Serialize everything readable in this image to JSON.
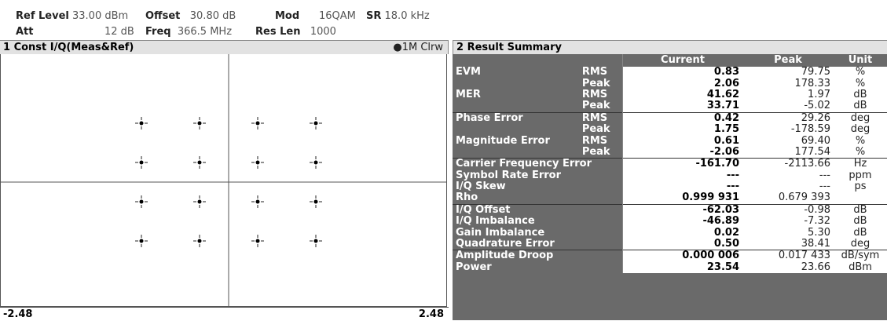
{
  "header": {
    "ref_level_label": "Ref Level",
    "ref_level_value": "33.00 dBm",
    "offset_label": "Offset",
    "offset_value": "30.80 dB",
    "mod_label": "Mod",
    "mod_value": "16QAM",
    "sr_label": "SR",
    "sr_value": "18.0 kHz",
    "att_label": "Att",
    "att_value": "12 dB",
    "freq_label": "Freq",
    "freq_value": "366.5 MHz",
    "reslen_label": "Res Len",
    "reslen_value": "1000"
  },
  "const_panel": {
    "title": "1 Const I/Q(Meas&Ref)",
    "trace_label": "●1M Clrw",
    "x_min": "-2.48",
    "x_max": "2.48",
    "points": [
      {
        "i": -3,
        "q": 3
      },
      {
        "i": -1,
        "q": 3
      },
      {
        "i": 1,
        "q": 3
      },
      {
        "i": 3,
        "q": 3
      },
      {
        "i": -3,
        "q": 1
      },
      {
        "i": -1,
        "q": 1
      },
      {
        "i": 1,
        "q": 1
      },
      {
        "i": 3,
        "q": 1
      },
      {
        "i": -3,
        "q": -1
      },
      {
        "i": -1,
        "q": -1
      },
      {
        "i": 1,
        "q": -1
      },
      {
        "i": 3,
        "q": -1
      },
      {
        "i": -3,
        "q": -3
      },
      {
        "i": -1,
        "q": -3
      },
      {
        "i": 1,
        "q": -3
      },
      {
        "i": 3,
        "q": -3
      }
    ]
  },
  "summary": {
    "title": "2 Result Summary",
    "col_current": "Current",
    "col_peak": "Peak",
    "col_unit": "Unit",
    "rows": [
      {
        "label": "EVM",
        "sub": "RMS",
        "current": "0.83",
        "peak": "79.75",
        "unit": "%",
        "sep": false
      },
      {
        "label": "",
        "sub": "Peak",
        "current": "2.06",
        "peak": "178.33",
        "unit": "%",
        "sep": false
      },
      {
        "label": "MER",
        "sub": "RMS",
        "current": "41.62",
        "peak": "1.97",
        "unit": "dB",
        "sep": false
      },
      {
        "label": "",
        "sub": "Peak",
        "current": "33.71",
        "peak": "-5.02",
        "unit": "dB",
        "sep": false
      },
      {
        "label": "Phase Error",
        "sub": "RMS",
        "current": "0.42",
        "peak": "29.26",
        "unit": "deg",
        "sep": true
      },
      {
        "label": "",
        "sub": "Peak",
        "current": "1.75",
        "peak": "-178.59",
        "unit": "deg",
        "sep": false
      },
      {
        "label": "Magnitude Error",
        "sub": "RMS",
        "current": "0.61",
        "peak": "69.40",
        "unit": "%",
        "sep": false
      },
      {
        "label": "",
        "sub": "Peak",
        "current": "-2.06",
        "peak": "177.54",
        "unit": "%",
        "sep": false
      },
      {
        "label": "Carrier Frequency Error",
        "sub": "",
        "current": "-161.70",
        "peak": "-2113.66",
        "unit": "Hz",
        "sep": true
      },
      {
        "label": "Symbol Rate Error",
        "sub": "",
        "current": "---",
        "peak": "---",
        "unit": "ppm",
        "sep": false
      },
      {
        "label": "I/Q Skew",
        "sub": "",
        "current": "---",
        "peak": "---",
        "unit": "ps",
        "sep": false
      },
      {
        "label": "Rho",
        "sub": "",
        "current": "0.999 931",
        "peak": "0.679 393",
        "unit": "",
        "sep": false
      },
      {
        "label": "I/Q Offset",
        "sub": "",
        "current": "-62.03",
        "peak": "-0.98",
        "unit": "dB",
        "sep": true
      },
      {
        "label": "I/Q Imbalance",
        "sub": "",
        "current": "-46.89",
        "peak": "-7.32",
        "unit": "dB",
        "sep": false
      },
      {
        "label": "Gain Imbalance",
        "sub": "",
        "current": "0.02",
        "peak": "5.30",
        "unit": "dB",
        "sep": false
      },
      {
        "label": "Quadrature Error",
        "sub": "",
        "current": "0.50",
        "peak": "38.41",
        "unit": "deg",
        "sep": false
      },
      {
        "label": "Amplitude Droop",
        "sub": "",
        "current": "0.000 006",
        "peak": "0.017 433",
        "unit": "dB/sym",
        "sep": true
      },
      {
        "label": "Power",
        "sub": "",
        "current": "23.54",
        "peak": "23.66",
        "unit": "dBm",
        "sep": false
      }
    ]
  }
}
